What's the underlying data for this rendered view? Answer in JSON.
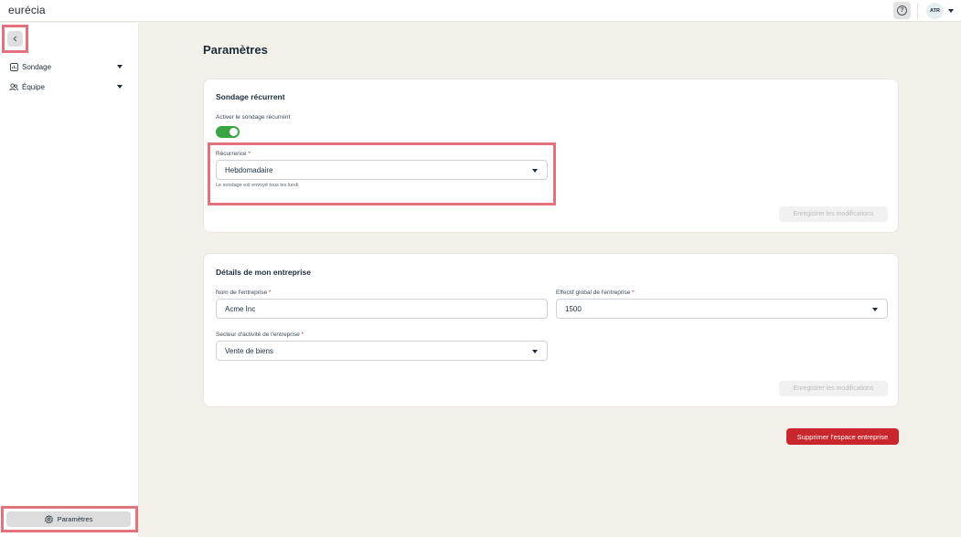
{
  "app": {
    "logo_text": "eurécia"
  },
  "topbar": {
    "help_icon_text": "?",
    "user_initials": "ATR"
  },
  "sidebar": {
    "items": [
      {
        "label": "Sondage",
        "icon": "chart-icon"
      },
      {
        "label": "Équipe",
        "icon": "team-icon"
      }
    ],
    "settings_label": "Paramètres"
  },
  "page": {
    "title": "Paramètres"
  },
  "survey_card": {
    "title": "Sondage récurrent",
    "toggle_label": "Activer le sondage récurrent",
    "toggle_on": true,
    "recurrence_label": "Récurrence",
    "recurrence_value": "Hebdomadaire",
    "recurrence_helper": "Le sondage est envoyé tous les lundi",
    "save_label": "Enregistrer les modifications"
  },
  "company_card": {
    "title": "Détails de mon entreprise",
    "name_label": "Nom de l'entreprise",
    "name_value": "Acme Inc",
    "headcount_label": "Effectif global de l'entreprise",
    "headcount_value": "1500",
    "sector_label": "Secteur d'activité de l'entreprise",
    "sector_value": "Vente de biens",
    "save_label": "Enregistrer les modifications"
  },
  "delete_label": "Supprimer l'espace entreprise",
  "required_mark": "*",
  "colors": {
    "accent_green": "#3aa343",
    "danger_red": "#c9262d",
    "highlight": "#e2737c"
  }
}
